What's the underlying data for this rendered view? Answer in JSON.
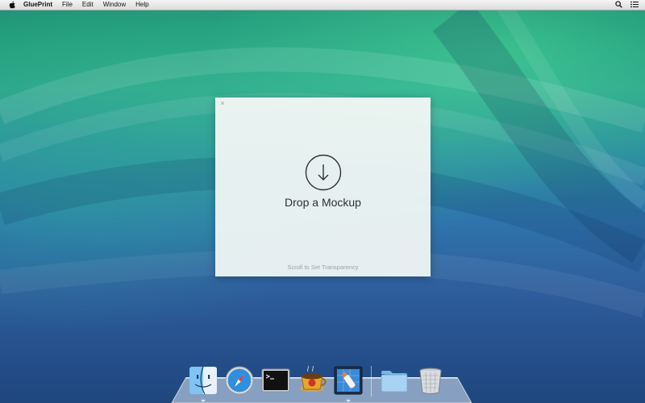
{
  "menubar": {
    "apple_icon": "apple-icon",
    "app_name": "GluePrint",
    "items": [
      "File",
      "Edit",
      "Window",
      "Help"
    ],
    "right_icons": [
      "search-icon",
      "list-icon"
    ]
  },
  "drop_window": {
    "close_symbol": "×",
    "title": "Drop a Mockup",
    "hint": "Scroll to Set Transparency",
    "icon": "download-arrow-icon"
  },
  "dock": {
    "apps": [
      {
        "name": "Finder",
        "icon": "finder-icon",
        "running": true
      },
      {
        "name": "Safari",
        "icon": "safari-icon",
        "running": false
      },
      {
        "name": "Terminal",
        "icon": "terminal-icon",
        "running": false
      },
      {
        "name": "Espresso",
        "icon": "espresso-icon",
        "running": false
      },
      {
        "name": "GluePrint",
        "icon": "glueprint-icon",
        "running": true
      }
    ],
    "stacks": [
      {
        "name": "Folder",
        "icon": "folder-icon"
      },
      {
        "name": "Trash",
        "icon": "trash-icon"
      }
    ]
  },
  "colors": {
    "desktop_top": "#1f9a7a",
    "desktop_bottom": "#1f477e",
    "window_bg": "#eef4f3",
    "title_text": "#2c2f31",
    "hint_text": "#9aa3a4"
  }
}
